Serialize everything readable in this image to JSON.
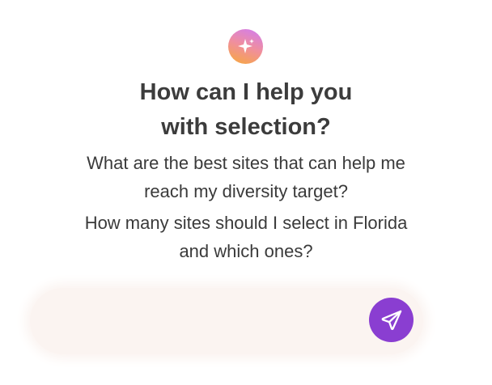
{
  "header": {
    "logo_icon": "sparkle-icon",
    "title_line1": "How can I help you",
    "title_line2": "with selection?"
  },
  "suggestions": [
    {
      "line1": "What are the best sites that can help me",
      "line2": "reach my diversity target?"
    },
    {
      "line1": "How many sites should I select in Florida",
      "line2": "and which ones?"
    }
  ],
  "input": {
    "value": "",
    "placeholder": ""
  },
  "send_button": {
    "icon": "paper-plane-icon"
  },
  "colors": {
    "accent": "#8a3ed1",
    "input_background": "#fbf4f1",
    "text": "#3c3c3c"
  }
}
